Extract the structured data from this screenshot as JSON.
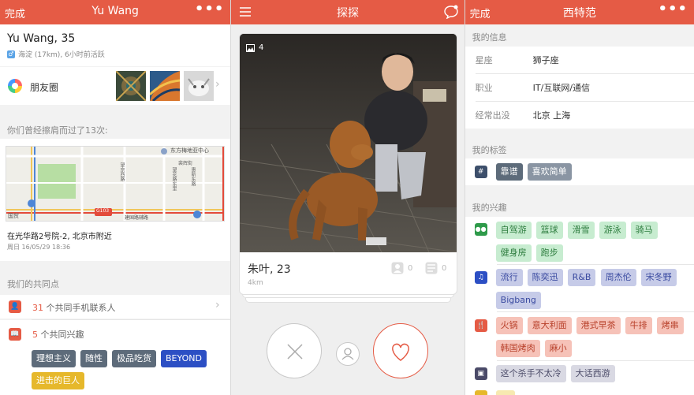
{
  "left_screen": {
    "header": {
      "done_label": "完成",
      "title": "Yu Wang",
      "more_label": "•••"
    },
    "profile": {
      "name_age": "Yu Wang, 35",
      "gender_icon": "male-icon",
      "location_status": "海淀 (17km), 6小时前活跃"
    },
    "moments": {
      "label": "朋友圈",
      "icon": "moments-icon"
    },
    "encounter": {
      "title": "你们曾经擦肩而过了13次:",
      "map_labels": [
        "东方梅地亚中心",
        "裴辉街",
        "望花路东里",
        "望京西路",
        "惠新东路",
        "建国路辅路",
        "国贸",
        "G103"
      ],
      "address": "在光华路2号院-2, 北京市附近",
      "time": "周日 16/05/29 18:36"
    },
    "common": {
      "title": "我们的共同点",
      "contacts_count": "31",
      "contacts_text": " 个共同手机联系人",
      "interests_count": "5",
      "interests_text": " 个共同兴趣",
      "tags": [
        "理想主义",
        "随性",
        "极品吃货",
        "BEYOND",
        "进击的巨人"
      ]
    },
    "colors": {
      "accent": "#e55b45",
      "tag_gray": "#5d6b7a",
      "tag_blue": "#2c4fc4",
      "tag_yellow": "#e6b82b"
    }
  },
  "middle_screen": {
    "header": {
      "menu_icon": "hamburger-icon",
      "title": "探探",
      "chat_icon": "chat-bubble-icon"
    },
    "card": {
      "photo_count": "4",
      "name_age": "朱叶, 23",
      "distance": "4km",
      "friends_count": "0",
      "moments_count": "0"
    },
    "actions": {
      "dislike": "close-icon",
      "profile": "profile-icon",
      "like": "heart-icon"
    }
  },
  "right_screen": {
    "header": {
      "done_label": "完成",
      "title": "西特范",
      "more_label": "•••"
    },
    "info": {
      "title": "我的信息",
      "rows": [
        {
          "label": "星座",
          "value": "狮子座"
        },
        {
          "label": "职业",
          "value": "IT/互联网/通信"
        },
        {
          "label": "经常出没",
          "value": "北京 上海"
        }
      ]
    },
    "tags_section": {
      "title": "我的标签",
      "tags": [
        "靠谱",
        "喜欢简单"
      ]
    },
    "interests": {
      "title": "我的兴趣",
      "sports": [
        "自驾游",
        "篮球",
        "滑雪",
        "游泳",
        "骑马",
        "健身房",
        "跑步"
      ],
      "music": [
        "流行",
        "陈奕迅",
        "R&B",
        "周杰伦",
        "宋冬野",
        "Bigbang"
      ],
      "food": [
        "火锅",
        "意大利面",
        "港式早茶",
        "牛排",
        "烤串",
        "韩国烤肉",
        "麻小"
      ],
      "movies": [
        "这个杀手不太冷",
        "大话西游"
      ]
    },
    "colors": {
      "sports_bg": "#c7ecd0",
      "sports_fg": "#2e7d3f",
      "music_bg": "#c6cbe8",
      "music_fg": "#3a4aa0",
      "food_bg": "#f6c2b8",
      "food_fg": "#b8402a",
      "movie_bg": "#d9d9e3",
      "movie_fg": "#4b4b68"
    }
  }
}
